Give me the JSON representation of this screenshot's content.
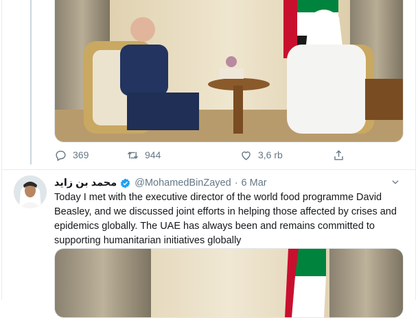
{
  "first_tweet": {
    "replies": "369",
    "retweets": "944",
    "likes": "3,6 rb",
    "icons": [
      "reply-icon",
      "retweet-icon",
      "like-icon",
      "share-icon"
    ]
  },
  "second_tweet": {
    "display_name": "محمد بن زايد",
    "handle": "@MohamedBinZayed",
    "separator": "·",
    "date": "6 Mar",
    "text": "Today I met with the executive director of the world food programme David Beasley, and we discussed joint efforts in helping those affected by crises and epidemics globally. The UAE has always been and remains committed to supporting humanitarian initiatives globally",
    "icons": [
      "verified-badge-icon",
      "chevron-down-icon"
    ]
  },
  "colors": {
    "muted": "#657786",
    "text": "#14171a",
    "verified": "#1da1f2",
    "border": "#e6ecf0"
  }
}
